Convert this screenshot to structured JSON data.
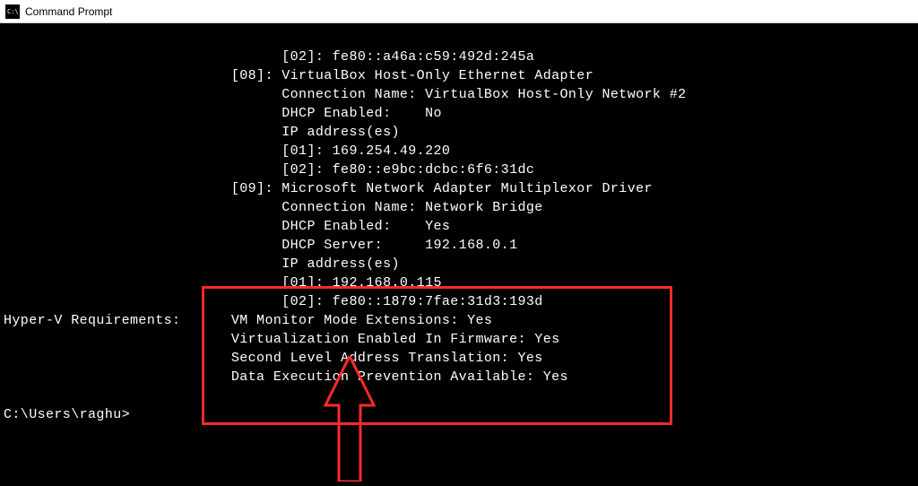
{
  "window": {
    "title": "Command Prompt"
  },
  "terminal": {
    "lines": [
      "                                 [02]: fe80::a46a:c59:492d:245a",
      "                           [08]: VirtualBox Host-Only Ethernet Adapter",
      "                                 Connection Name: VirtualBox Host-Only Network #2",
      "                                 DHCP Enabled:    No",
      "                                 IP address(es)",
      "                                 [01]: 169.254.49.220",
      "                                 [02]: fe80::e9bc:dcbc:6f6:31dc",
      "                           [09]: Microsoft Network Adapter Multiplexor Driver",
      "                                 Connection Name: Network Bridge",
      "                                 DHCP Enabled:    Yes",
      "                                 DHCP Server:     192.168.0.1",
      "                                 IP address(es)",
      "                                 [01]: 192.168.0.115",
      "                                 [02]: fe80::1879:7fae:31d3:193d",
      "Hyper-V Requirements:      VM Monitor Mode Extensions: Yes",
      "                           Virtualization Enabled In Firmware: Yes",
      "                           Second Level Address Translation: Yes",
      "                           Data Execution Prevention Available: Yes",
      "",
      "C:\\Users\\raghu>"
    ]
  },
  "highlight_color": "#ff2a2a"
}
